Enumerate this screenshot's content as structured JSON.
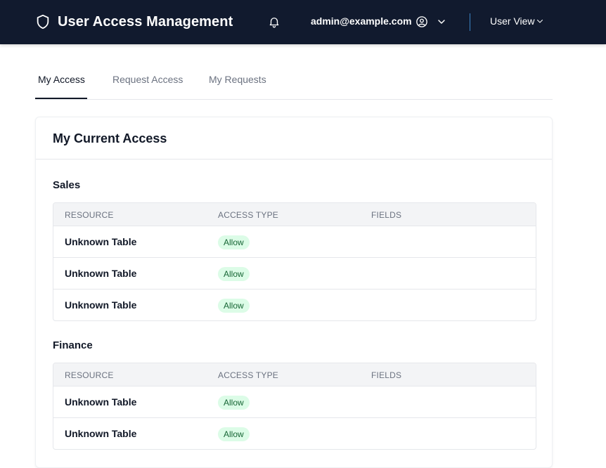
{
  "header": {
    "title": "User Access Management",
    "brand_icon": "shield-icon",
    "notification_icon": "bell-icon",
    "user_email": "admin@example.com",
    "user_icon": "user-circle-icon",
    "view_label": "User View",
    "colors": {
      "bar": "#111a2e",
      "divider": "#3b82c4"
    }
  },
  "tabs": [
    {
      "label": "My Access",
      "active": true
    },
    {
      "label": "Request Access",
      "active": false
    },
    {
      "label": "My Requests",
      "active": false
    }
  ],
  "card": {
    "title": "My Current Access",
    "columns": [
      "RESOURCE",
      "ACCESS TYPE",
      "FIELDS"
    ],
    "groups": [
      {
        "name": "Sales",
        "rows": [
          {
            "resource": "Unknown Table",
            "access_type": "Allow",
            "fields": ""
          },
          {
            "resource": "Unknown Table",
            "access_type": "Allow",
            "fields": ""
          },
          {
            "resource": "Unknown Table",
            "access_type": "Allow",
            "fields": ""
          }
        ]
      },
      {
        "name": "Finance",
        "rows": [
          {
            "resource": "Unknown Table",
            "access_type": "Allow",
            "fields": ""
          },
          {
            "resource": "Unknown Table",
            "access_type": "Allow",
            "fields": ""
          }
        ]
      }
    ],
    "colors": {
      "allow_bg": "#dcfce7",
      "allow_text": "#166534"
    }
  }
}
